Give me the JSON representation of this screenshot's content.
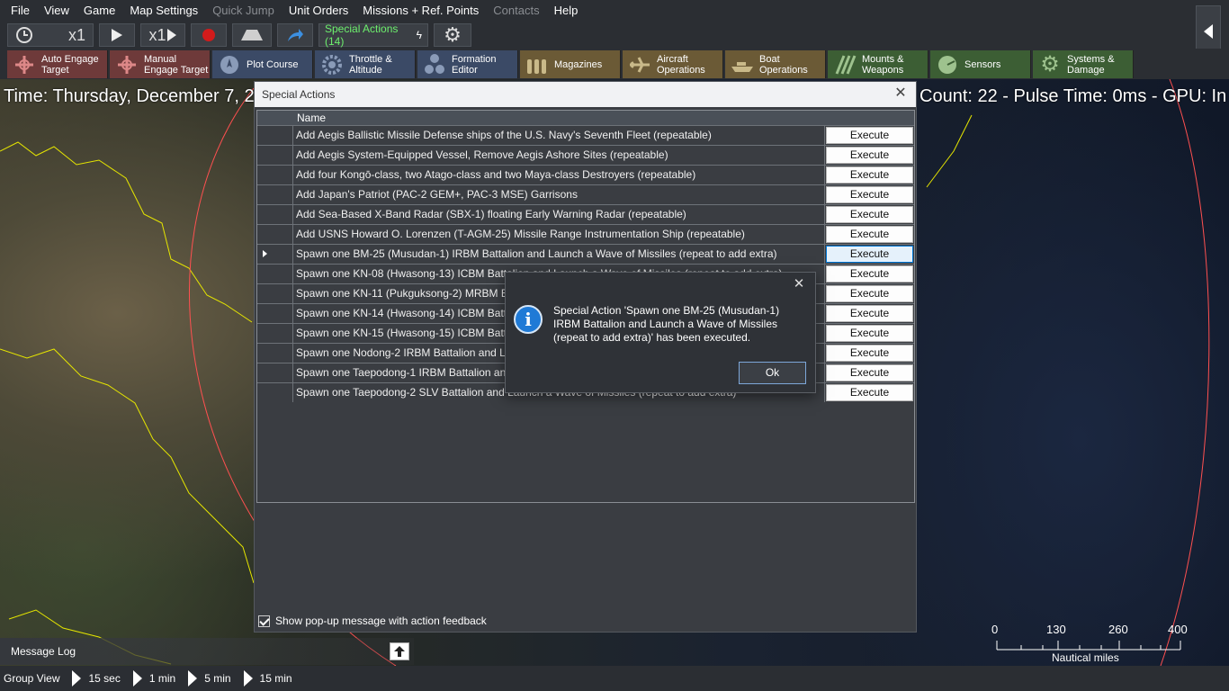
{
  "menu": [
    "File",
    "View",
    "Game",
    "Map Settings",
    "Quick Jump",
    "Unit Orders",
    "Missions + Ref. Points",
    "Contacts",
    "Help"
  ],
  "menu_disabled": [
    "Quick Jump",
    "Contacts"
  ],
  "toolbar": {
    "time_compression": "x1",
    "step": "x1",
    "special_actions": "Special Actions (14)"
  },
  "tabs": {
    "auto_engage": "Auto Engage Target",
    "manual_engage": "Manual Engage Target",
    "plot_course": "Plot Course",
    "throttle": "Throttle & Altitude",
    "formation": "Formation Editor",
    "magazines": "Magazines",
    "aircraft_ops": "Aircraft Operations",
    "boat_ops": "Boat Operations",
    "mounts": "Mounts & Weapons",
    "sensors": "Sensors",
    "systems": "Systems & Damage"
  },
  "map": {
    "time_left": "Time: Thursday, December 7, 2",
    "time_right": "Count: 22 - Pulse Time: 0ms - GPU: In"
  },
  "special_actions_window": {
    "title": "Special Actions",
    "column_name": "Name",
    "execute_label": "Execute",
    "rows": [
      "Add Aegis Ballistic Missile Defense ships of the U.S. Navy's Seventh Fleet (repeatable)",
      "Add Aegis System-Equipped Vessel, Remove Aegis Ashore Sites (repeatable)",
      "Add four Kongō-class, two Atago-class and two Maya-class Destroyers (repeatable)",
      "Add Japan's Patriot (PAC-2 GEM+, PAC-3 MSE) Garrisons",
      "Add Sea-Based X-Band Radar (SBX-1) floating Early Warning Radar (repeatable)",
      "Add USNS Howard O. Lorenzen (T-AGM-25) Missile Range Instrumentation Ship (repeatable)",
      "Spawn one BM-25 (Musudan-1) IRBM Battalion and Launch a Wave of Missiles (repeat to add extra)",
      "Spawn one KN-08 (Hwasong-13) ICBM Battalion and Launch a Wave of Missiles (repeat to add extra)",
      "Spawn one KN-11 (Pukguksong-2) MRBM B",
      "Spawn one KN-14 (Hwasong-14) ICBM Batta",
      "Spawn one KN-15 (Hwasong-15) ICBM Batta",
      "Spawn one Nodong-2 IRBM Battalion and La",
      "Spawn one Taepodong-1 IRBM Battalion and",
      "Spawn one Taepodong-2 SLV Battalion and Launch a Wave of Missiles (repeat to add extra)"
    ],
    "selected_row": 6,
    "feedback_label": "Show pop-up message with action feedback",
    "feedback_checked": true
  },
  "info_dialog": {
    "message": "Special Action 'Spawn one BM-25 (Musudan-1) IRBM Battalion and Launch a Wave of Missiles (repeat to add extra)' has been executed.",
    "ok_label": "Ok"
  },
  "message_log": {
    "label": "Message Log"
  },
  "scale": {
    "ticks": [
      "0",
      "130",
      "260",
      "400"
    ],
    "unit": "Nautical miles"
  },
  "bottom_bar": {
    "group_view": "Group View",
    "steps": [
      "15 sec",
      "1 min",
      "5 min",
      "15 min"
    ]
  },
  "colors": {
    "special_actions_text": "#6df06d",
    "map_border_lines": "#e6e600",
    "range_ring": "#ff5050",
    "accent": "#0078d7"
  }
}
